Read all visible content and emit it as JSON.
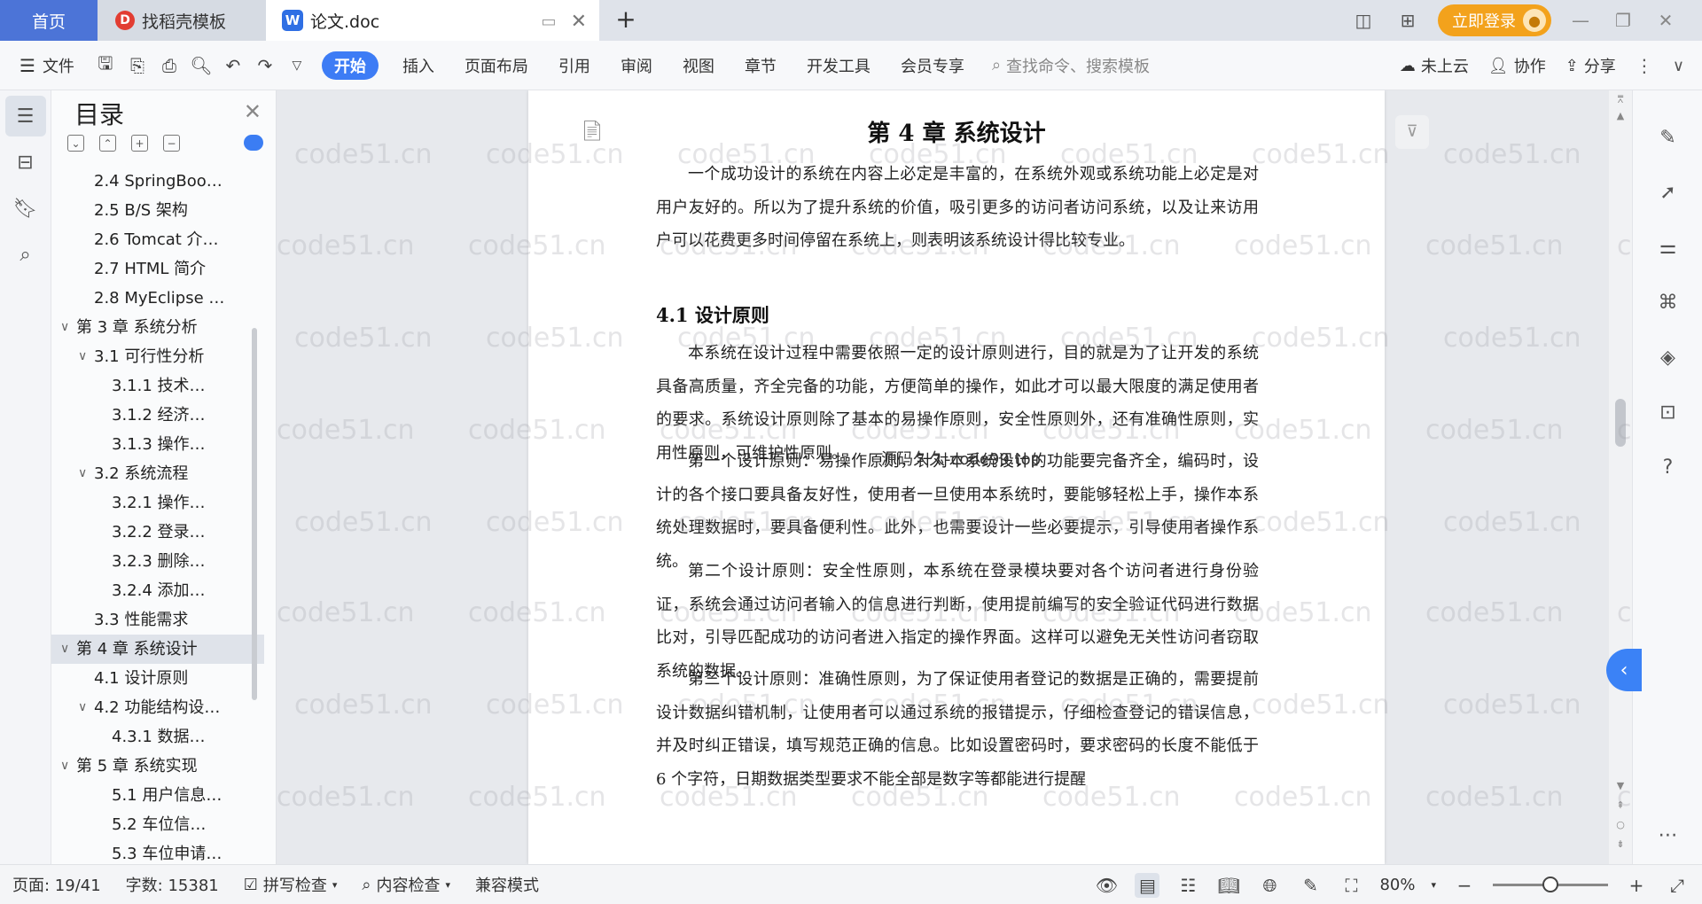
{
  "tabs": {
    "home": "首页",
    "daoke": "找稻壳模板",
    "doc": "论文.doc"
  },
  "header": {
    "login": "立即登录"
  },
  "toolbar": {
    "file": "文件",
    "menus": [
      "开始",
      "插入",
      "页面布局",
      "引用",
      "审阅",
      "视图",
      "章节",
      "开发工具",
      "会员专享"
    ],
    "search_placeholder": "查找命令、搜索模板",
    "cloud": "未上云",
    "collab": "协作",
    "share": "分享"
  },
  "toc": {
    "title": "目录",
    "items": [
      {
        "label": "2.4 SpringBoo…",
        "level": 2,
        "arrow": false
      },
      {
        "label": "2.5 B/S 架构",
        "level": 2,
        "arrow": false
      },
      {
        "label": "2.6 Tomcat 介…",
        "level": 2,
        "arrow": false
      },
      {
        "label": "2.7 HTML 简介",
        "level": 2,
        "arrow": false
      },
      {
        "label": "2.8 MyEclipse …",
        "level": 2,
        "arrow": false
      },
      {
        "label": "第 3 章 系统分析",
        "level": 1,
        "arrow": true
      },
      {
        "label": "3.1 可行性分析",
        "level": 2,
        "arrow": true
      },
      {
        "label": "3.1.1 技术…",
        "level": 3,
        "arrow": false
      },
      {
        "label": "3.1.2 经济…",
        "level": 3,
        "arrow": false
      },
      {
        "label": "3.1.3 操作…",
        "level": 3,
        "arrow": false
      },
      {
        "label": "3.2 系统流程",
        "level": 2,
        "arrow": true
      },
      {
        "label": "3.2.1 操作…",
        "level": 3,
        "arrow": false
      },
      {
        "label": "3.2.2 登录…",
        "level": 3,
        "arrow": false
      },
      {
        "label": "3.2.3 删除…",
        "level": 3,
        "arrow": false
      },
      {
        "label": "3.2.4 添加…",
        "level": 3,
        "arrow": false
      },
      {
        "label": "3.3 性能需求",
        "level": 2,
        "arrow": false
      },
      {
        "label": "第 4 章 系统设计",
        "level": 1,
        "arrow": true,
        "active": true
      },
      {
        "label": "4.1 设计原则",
        "level": 2,
        "arrow": false
      },
      {
        "label": "4.2 功能结构设…",
        "level": 2,
        "arrow": true
      },
      {
        "label": "4.3.1 数据…",
        "level": 3,
        "arrow": false
      },
      {
        "label": "第 5 章 系统实现",
        "level": 1,
        "arrow": true
      },
      {
        "label": "5.1 用户信息…",
        "level": 3,
        "arrow": false
      },
      {
        "label": "5.2 车位信…",
        "level": 3,
        "arrow": false
      },
      {
        "label": "5.3 车位申请…",
        "level": 3,
        "arrow": false
      }
    ]
  },
  "document": {
    "chapter_title": "第 4 章  系统设计",
    "intro": "一个成功设计的系统在内容上必定是丰富的，在系统外观或系统功能上必定是对用户友好的。所以为了提升系统的价值，吸引更多的访问者访问系统，以及让来访用户可以花费更多时间停留在系统上，则表明该系统设计得比较专业。",
    "section_title": "4.1  设计原则",
    "p1": "本系统在设计过程中需要依照一定的设计原则进行，目的就是为了让开发的系统具备高质量，齐全完备的功能，方便简单的操作，如此才可以最大限度的满足使用者的要求。系统设计原则除了基本的易操作原则，安全性原则外，还有准确性原则，实用性原则，可维护性原则。",
    "p2": "第一个设计原则：易操作原则，针对本系统设计的功能要完备齐全，编码时，设计的各个接口要具备友好性，使用者一旦使用本系统时，要能够轻松上手，操作本系统处理数据时，要具备便利性。此外，也需要设计一些必要提示，引导使用者操作系统。",
    "p3": "第二个设计原则：安全性原则，本系统在登录模块要对各个访问者进行身份验证，系统会通过访问者输入的信息进行判断，使用提前编写的安全验证代码进行数据比对，引导匹配成功的访问者进入指定的操作界面。这样可以避免无关性访问者窃取系统的数据。",
    "p4": "第三个设计原则：准确性原则，为了保证使用者登记的数据是正确的，需要提前设计数据纠错机制，让使用者可以通过系统的报错提示，仔细检查登记的错误信息，并及时纠正错误，填写规范正确的信息。比如设置密码时，要求密码的长度不能低于 6 个字符，日期数据类型要求不能全部是数字等都能进行提醒",
    "watermark_center": "源码久久-code99.top",
    "watermark": "code51.cn"
  },
  "status": {
    "page": "页面: 19/41",
    "words": "字数: 15381",
    "spell": "拼写检查",
    "content": "内容检查",
    "compat": "兼容模式",
    "zoom": "80%",
    "zoom_fraction": 0.5
  }
}
